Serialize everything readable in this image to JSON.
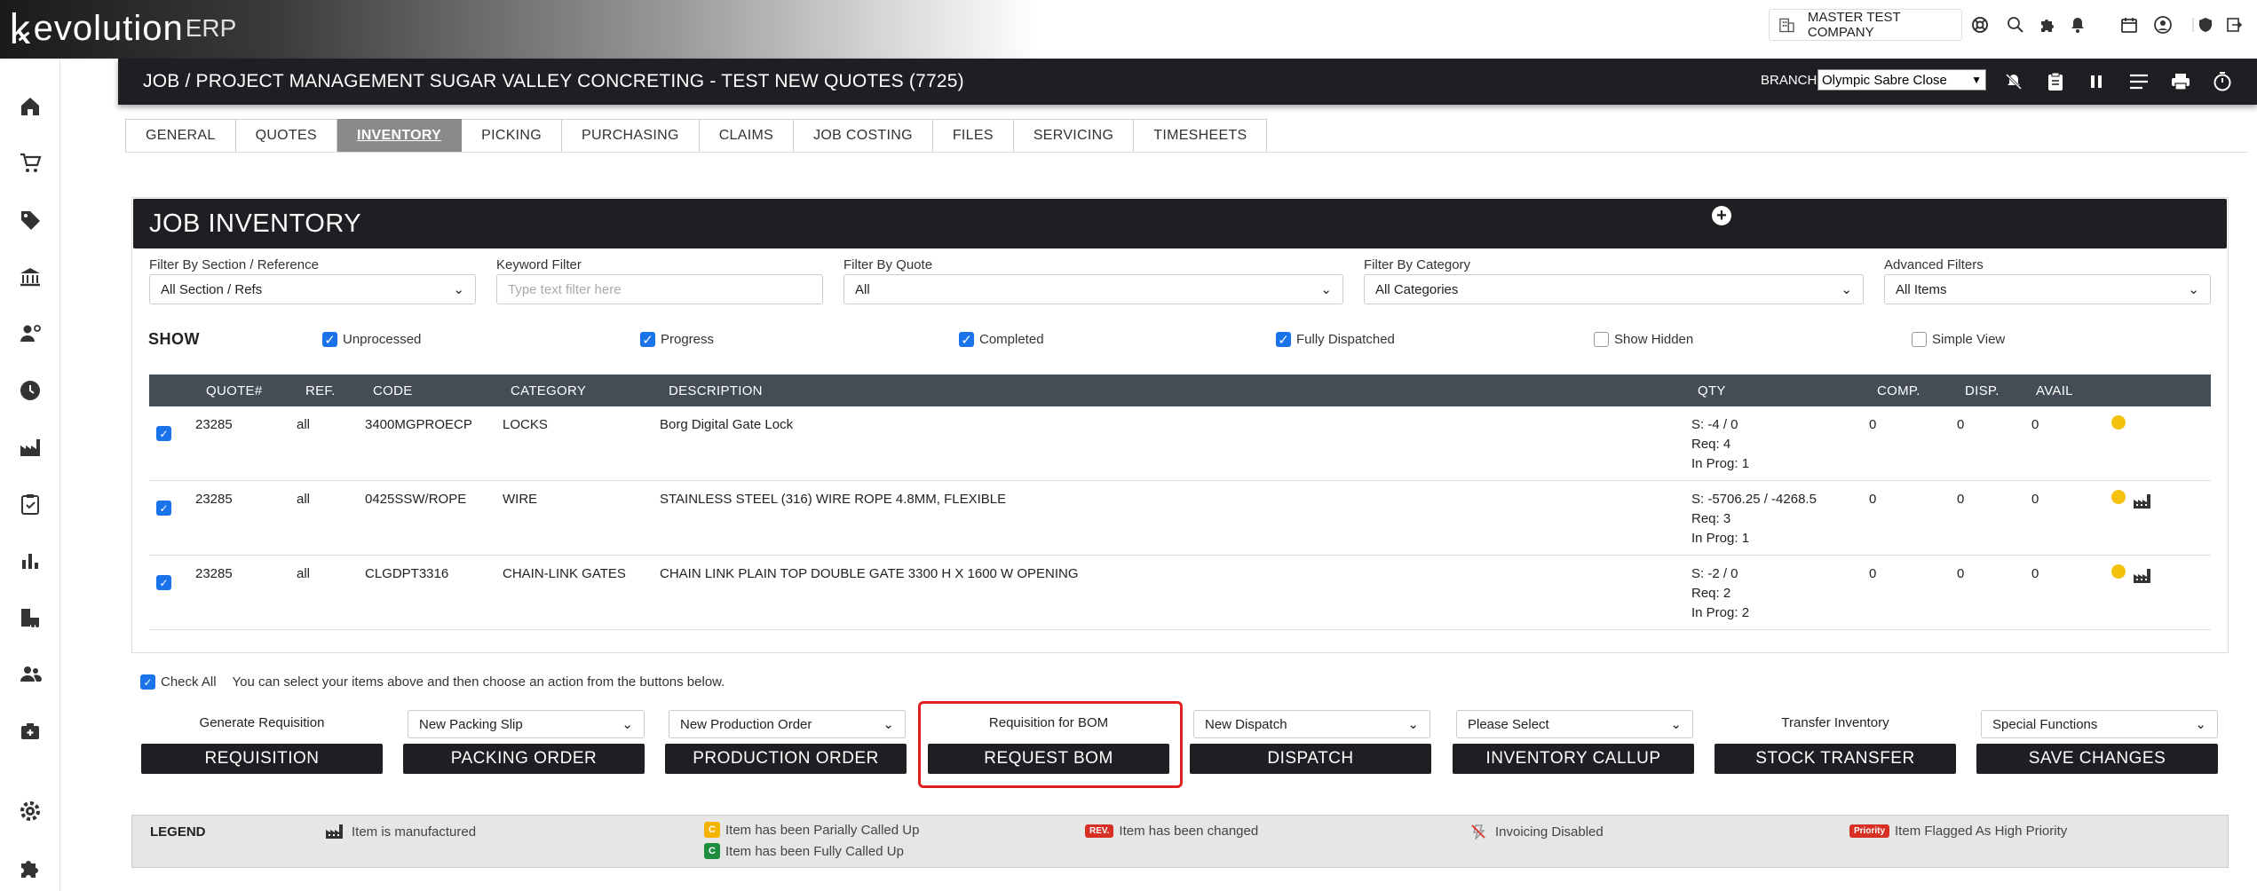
{
  "app": {
    "logo_main": "evolution",
    "logo_suffix": "ERP",
    "company": "MASTER TEST COMPANY"
  },
  "job": {
    "title": "JOB / PROJECT MANAGEMENT SUGAR VALLEY CONCRETING - TEST NEW QUOTES (7725)",
    "branch_label": "BRANCH:",
    "branch_value": "Olympic Sabre Close"
  },
  "tabs": [
    "GENERAL",
    "QUOTES",
    "INVENTORY",
    "PICKING",
    "PURCHASING",
    "CLAIMS",
    "JOB COSTING",
    "FILES",
    "SERVICING",
    "TIMESHEETS"
  ],
  "active_tab": "INVENTORY",
  "panel": {
    "title": "JOB INVENTORY"
  },
  "filters": {
    "section": {
      "label": "Filter By Section / Reference",
      "value": "All Section / Refs"
    },
    "keyword": {
      "label": "Keyword Filter",
      "placeholder": "Type text filter here"
    },
    "quote": {
      "label": "Filter By Quote",
      "value": "All"
    },
    "category": {
      "label": "Filter By Category",
      "value": "All Categories"
    },
    "advanced": {
      "label": "Advanced Filters",
      "value": "All Items"
    }
  },
  "show": {
    "label": "SHOW",
    "options": [
      {
        "label": "Unprocessed",
        "checked": true
      },
      {
        "label": "Progress",
        "checked": true
      },
      {
        "label": "Completed",
        "checked": true
      },
      {
        "label": "Fully Dispatched",
        "checked": true
      },
      {
        "label": "Show Hidden",
        "checked": false
      },
      {
        "label": "Simple View",
        "checked": false
      }
    ]
  },
  "table": {
    "headers": {
      "quote": "QUOTE#",
      "ref": "REF.",
      "code": "CODE",
      "category": "CATEGORY",
      "description": "DESCRIPTION",
      "qty": "QTY",
      "comp": "COMP.",
      "disp": "DISP.",
      "avail": "AVAIL"
    },
    "rows": [
      {
        "quote": "23285",
        "ref": "all",
        "code": "3400MGPROECP",
        "category": "LOCKS",
        "description": "Borg Digital Gate Lock",
        "qty_s": "S: -4 / 0",
        "qty_req": "Req: 4",
        "qty_prog": "In Prog: 1",
        "comp": "0",
        "disp": "0",
        "avail": "0",
        "manufactured": false
      },
      {
        "quote": "23285",
        "ref": "all",
        "code": "0425SSW/ROPE",
        "category": "WIRE",
        "description": "STAINLESS STEEL (316) WIRE ROPE 4.8MM, FLEXIBLE",
        "qty_s": "S: -5706.25 / -4268.5",
        "qty_req": "Req: 3",
        "qty_prog": "In Prog: 1",
        "comp": "0",
        "disp": "0",
        "avail": "0",
        "manufactured": true
      },
      {
        "quote": "23285",
        "ref": "all",
        "code": "CLGDPT3316",
        "category": "CHAIN-LINK GATES",
        "description": "CHAIN LINK PLAIN TOP DOUBLE GATE 3300 H X 1600 W OPENING",
        "qty_s": "S: -2 / 0",
        "qty_req": "Req: 2",
        "qty_prog": "In Prog: 2",
        "comp": "0",
        "disp": "0",
        "avail": "0",
        "manufactured": true
      }
    ]
  },
  "check_all": {
    "label": "Check All",
    "hint": "You can select your items above and then choose an action from the buttons below."
  },
  "actions": [
    {
      "top_label": "Generate Requisition",
      "top_type": "label",
      "button": "REQUISITION"
    },
    {
      "top_label": "New Packing Slip",
      "top_type": "select",
      "button": "PACKING ORDER"
    },
    {
      "top_label": "New Production Order",
      "top_type": "select",
      "button": "PRODUCTION ORDER"
    },
    {
      "top_label": "Requisition for BOM",
      "top_type": "label",
      "button": "REQUEST BOM"
    },
    {
      "top_label": "New Dispatch",
      "top_type": "select",
      "button": "DISPATCH"
    },
    {
      "top_label": "Please Select",
      "top_type": "select",
      "button": "INVENTORY CALLUP"
    },
    {
      "top_label": "Transfer Inventory",
      "top_type": "label",
      "button": "STOCK TRANSFER"
    },
    {
      "top_label": "Special Functions",
      "top_type": "select",
      "button": "SAVE CHANGES"
    }
  ],
  "legend": {
    "title": "LEGEND",
    "manufactured": "Item is manufactured",
    "partial": {
      "badge": "C",
      "text": "Item has been Parially Called Up"
    },
    "full": {
      "badge": "C",
      "text": "Item has been Fully Called Up"
    },
    "changed": {
      "badge": "REV.",
      "text": "Item has been changed"
    },
    "invoicing": "Invoicing Disabled",
    "priority": {
      "badge": "Priority",
      "text": "Item Flagged As High Priority"
    }
  },
  "colors": {
    "header_dark": "#1d1f22",
    "table_header": "#444c55",
    "checkbox": "#1a73e8",
    "status_dot": "#f4c20d",
    "highlight": "#e02020",
    "badge_orange": "#f4b400",
    "badge_green": "#1e8e3e",
    "badge_red": "#d93025"
  }
}
